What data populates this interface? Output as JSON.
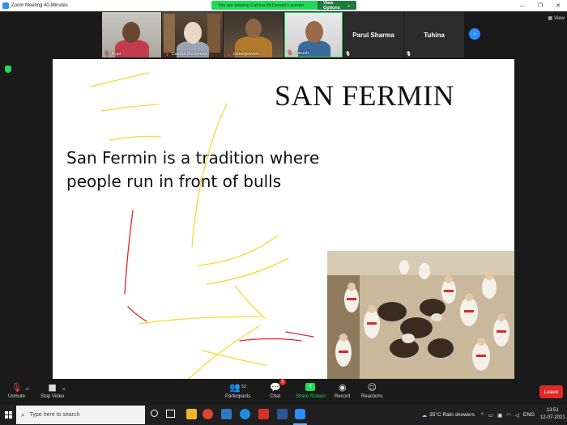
{
  "window": {
    "title": "Zoom Meeting 40-Minutes",
    "viewing_text": "You are viewing Catrina McDonald's screen",
    "view_options_label": "View Options",
    "view_label": "View"
  },
  "participants": [
    {
      "name": "Rupi",
      "muted": true
    },
    {
      "name": "Catrina McDonald",
      "muted": true
    },
    {
      "name": "chiranjeevsin...",
      "muted": true
    },
    {
      "name": "Aarush",
      "muted": true
    },
    {
      "name": "Parul Sharma",
      "muted": true
    },
    {
      "name": "Tuhina",
      "muted": true
    }
  ],
  "slide": {
    "title": "SAN FERMIN",
    "body_line1": "San Fermin is a tradition where",
    "body_line2": "people run in front of bulls"
  },
  "toolbar": {
    "unmute_label": "Unmute",
    "stop_video_label": "Stop Video",
    "participants_label": "Participants",
    "participants_count": "52",
    "chat_label": "Chat",
    "chat_badge": "3",
    "share_screen_label": "Share Screen",
    "record_label": "Record",
    "reactions_label": "Reactions",
    "leave_label": "Leave"
  },
  "taskbar": {
    "search_placeholder": "Type here to search",
    "weather": "35°C  Rain showers",
    "language": "ENG",
    "time": "13:51",
    "date": "12-07-2021"
  },
  "colors": {
    "zoom_green": "#23d959",
    "zoom_blue": "#2d8cff",
    "leave_red": "#e02828",
    "annotation_yellow": "#f2dc2c",
    "annotation_red": "#e8232b"
  }
}
